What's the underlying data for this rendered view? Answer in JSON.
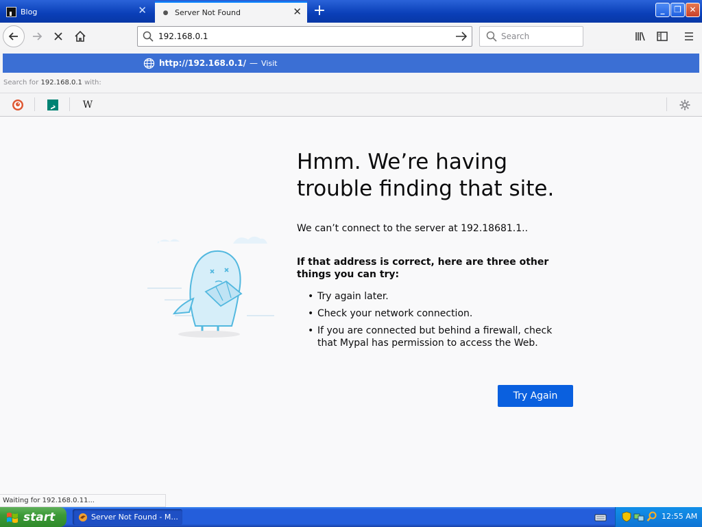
{
  "tabs": [
    {
      "title": "Blog",
      "active": false
    },
    {
      "title": "Server Not Found",
      "active": true
    }
  ],
  "urlbar": {
    "value": "192.168.0.1"
  },
  "searchbar": {
    "placeholder": "Search"
  },
  "dropdown": {
    "suggestion_url": "http://192.168.0.1/",
    "suggestion_sep": "—",
    "suggestion_action": "Visit",
    "search_for_prefix": "Search for",
    "search_for_query": "192.168.0.1",
    "search_for_suffix": "with:",
    "engines": [
      "duckduckgo-icon",
      "bing-icon",
      "wikipedia-icon"
    ],
    "wiki_glyph": "W"
  },
  "error": {
    "title": "Hmm. We’re having trouble finding that site.",
    "description": "We can’t connect to the server at 192.18681.1..",
    "subtitle": "If that address is correct, here are three other things you can try:",
    "tips": [
      "Try again later.",
      "Check your network connection.",
      "If you are connected but behind a firewall, check that Mypal has permission to access the Web."
    ],
    "button": "Try Again"
  },
  "status": {
    "text": "Waiting for 192.168.0.11..."
  },
  "taskbar": {
    "start": "start",
    "task": "Server Not Found - M...",
    "clock": "12:55 AM"
  },
  "colors": {
    "accent": "#0a60df",
    "suggestion_bg": "#3b6fd4"
  }
}
